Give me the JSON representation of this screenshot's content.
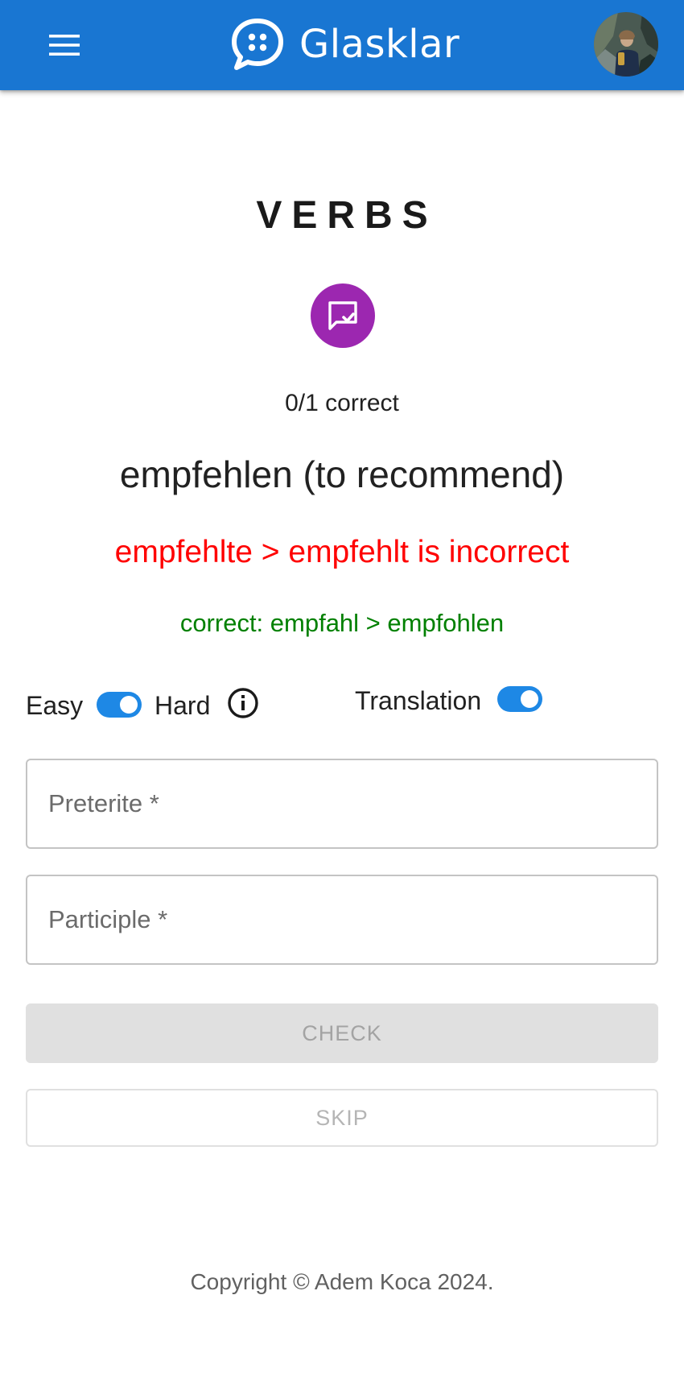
{
  "header": {
    "brand": "Glasklar",
    "menu_icon": "menu-icon",
    "logo_icon": "chat-bubble-logo-icon",
    "avatar_alt": "User avatar",
    "color": "#1976d2"
  },
  "page": {
    "title": "VERBS",
    "feedback_icon": "rate-review-check-icon",
    "feedback_color": "#9c27b0",
    "score": "0/1 correct",
    "verb": "empfehlen (to recommend)",
    "incorrect_message": "empfehlte > empfehlt is incorrect",
    "correct_message": "correct: empfahl > empfohlen"
  },
  "settings": {
    "easy_label": "Easy",
    "hard_label": "Hard",
    "difficulty_on": true,
    "info_icon": "info-icon",
    "translation_label": "Translation",
    "translation_on": true
  },
  "form": {
    "preterite_placeholder": "Preterite *",
    "preterite_value": "",
    "participle_placeholder": "Participle *",
    "participle_value": "",
    "check_label": "CHECK",
    "skip_label": "SKIP"
  },
  "footer": {
    "copyright": "Copyright © Adem Koca 2024."
  }
}
